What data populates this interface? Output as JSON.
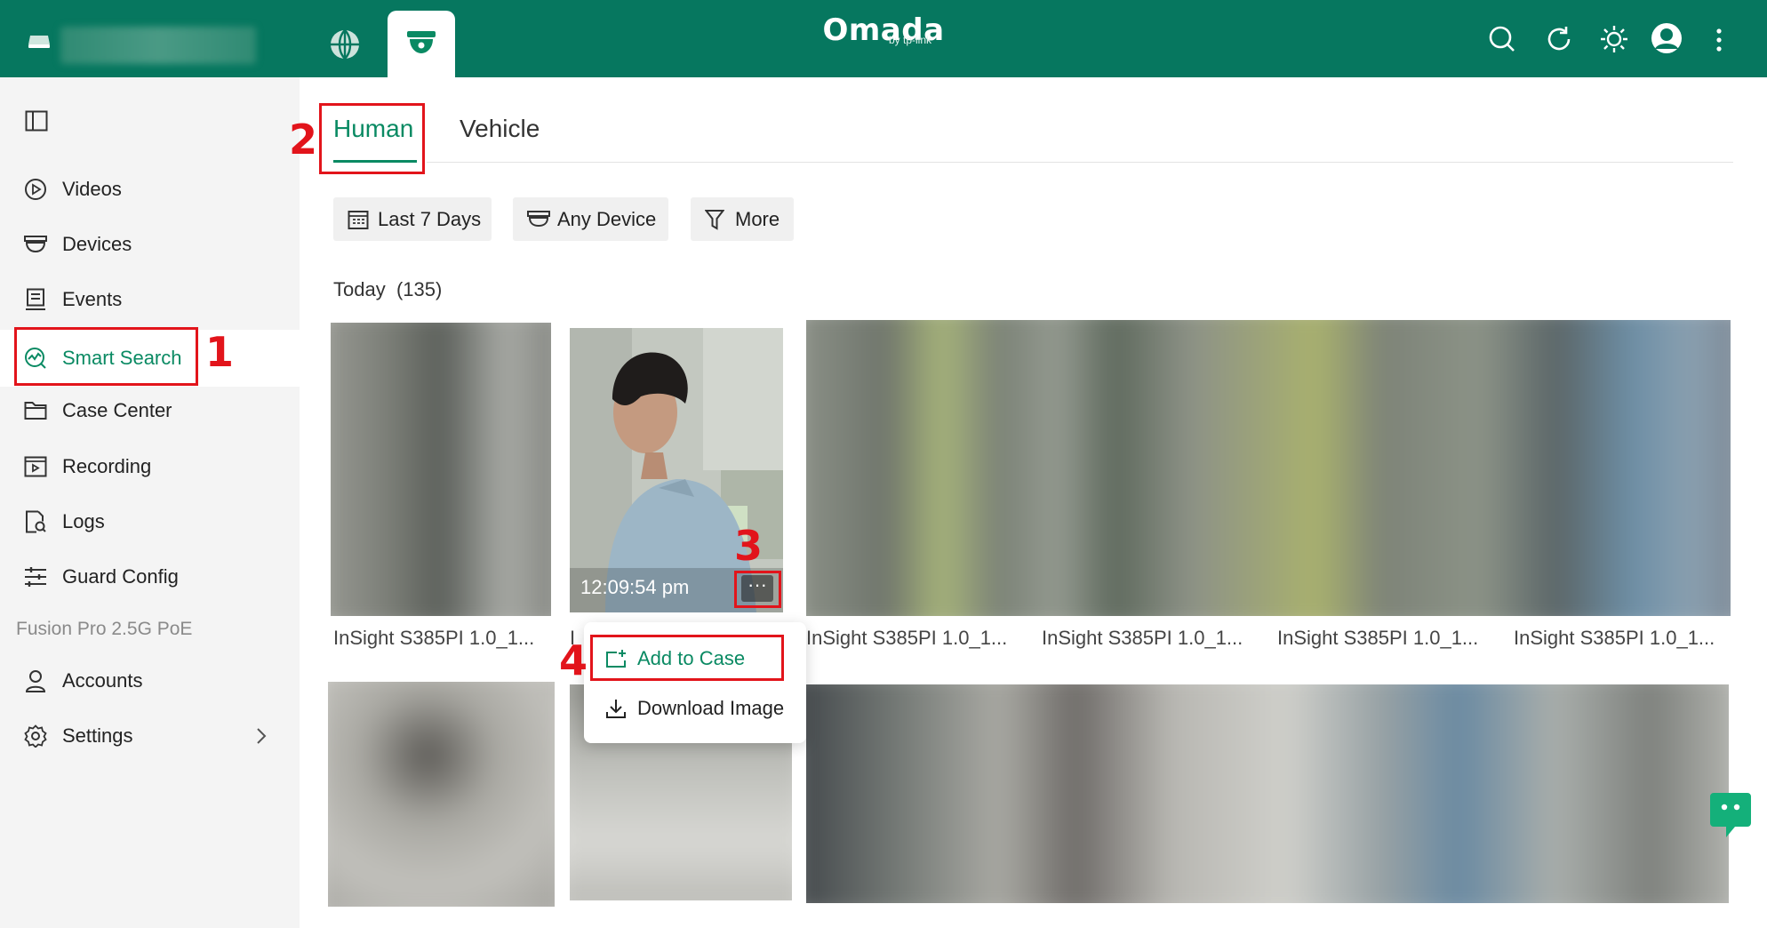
{
  "topbar": {
    "logo": "Omada",
    "logo_sub": "by tp-link",
    "icons": [
      "device-icon",
      "globe-icon",
      "surveillance-icon",
      "search-icon",
      "refresh-icon",
      "theme-icon",
      "avatar",
      "more-vertical-icon"
    ]
  },
  "sidebar": {
    "items": [
      {
        "label": "Videos",
        "icon": "play-circle-icon"
      },
      {
        "label": "Devices",
        "icon": "camera-dome-icon"
      },
      {
        "label": "Events",
        "icon": "events-icon"
      },
      {
        "label": "Smart Search",
        "icon": "smart-search-icon"
      },
      {
        "label": "Case Center",
        "icon": "folder-icon"
      },
      {
        "label": "Recording",
        "icon": "recording-icon"
      },
      {
        "label": "Logs",
        "icon": "logs-icon"
      },
      {
        "label": "Guard Config",
        "icon": "sliders-icon"
      }
    ],
    "section": "Fusion Pro 2.5G PoE",
    "bottom_items": [
      {
        "label": "Accounts",
        "icon": "user-icon"
      },
      {
        "label": "Settings",
        "icon": "gear-icon"
      }
    ]
  },
  "tabs": {
    "human": "Human",
    "vehicle": "Vehicle"
  },
  "filters": {
    "date": "Last 7 Days",
    "device": "Any Device",
    "more": "More"
  },
  "results": {
    "group_label": "Today",
    "group_count": "(135)",
    "captions": [
      "InSight S385PI 1.0_1...",
      "I",
      "InSight S385PI 1.0_1...",
      "InSight S385PI 1.0_1...",
      "InSight S385PI 1.0_1...",
      "InSight S385PI 1.0_1..."
    ],
    "time": "12:09:54 pm",
    "more_button": "···"
  },
  "context_menu": {
    "add_to_case": "Add to Case",
    "download_image": "Download Image"
  },
  "annotations": {
    "step1": "1",
    "step2": "2",
    "step3": "3",
    "step4": "4"
  },
  "colors": {
    "brand": "#06775f",
    "accent": "#0a8a63",
    "callout": "#e2141b"
  }
}
